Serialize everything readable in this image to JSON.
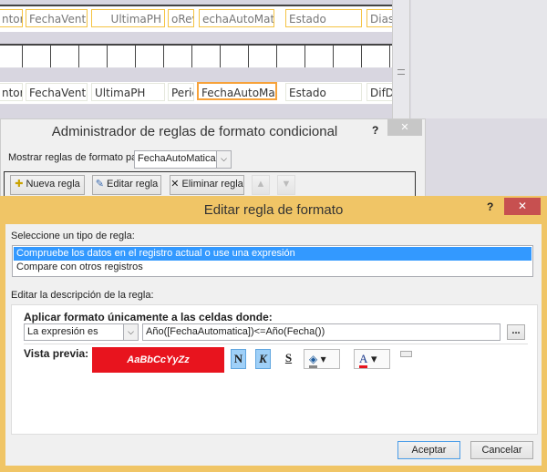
{
  "designer": {
    "row1": [
      "ntor",
      "FechaVenta",
      "UltimaPH",
      "oRev",
      "echaAutoMatica",
      "Estado",
      "Dias"
    ],
    "row3": [
      "ntor",
      "FechaVenta",
      "UltimaPH",
      "Peric",
      "FechaAutoMatic",
      "Estado",
      "DifDi"
    ]
  },
  "admin_dialog": {
    "title": "Administrador de reglas de formato condicional",
    "help": "?",
    "close": "✕",
    "show_rules_label": "Mostrar reglas de formato para:",
    "show_rules_value": "FechaAutoMatica",
    "new_rule": "Nueva regla",
    "edit_rule": "Editar regla",
    "delete_rule": "Eliminar regla"
  },
  "edit_dialog": {
    "title": "Editar regla de formato",
    "help": "?",
    "close": "✕",
    "rule_type_label": "Seleccione un tipo de regla:",
    "rule_types": [
      "Compruebe los datos en el registro actual o use una expresión",
      "Compare con otros registros"
    ],
    "selected_rule_type": 0,
    "description_label": "Editar la descripción de la regla:",
    "apply_label": "Aplicar formato únicamente a las celdas donde:",
    "condition_type": "La expresión es",
    "expression": "Año([FechaAutomatica])<=Año(Fecha())",
    "builder_button": "...",
    "preview_label": "Vista previa:",
    "preview_text": "AaBbCcYyZz",
    "preview_bg": "#e8141e",
    "bold": "N",
    "italic": "K",
    "underline": "S",
    "font_color_glyph": "A",
    "ok": "Aceptar",
    "cancel": "Cancelar",
    "accent": "#f0c566",
    "selection": "#3399ff"
  }
}
